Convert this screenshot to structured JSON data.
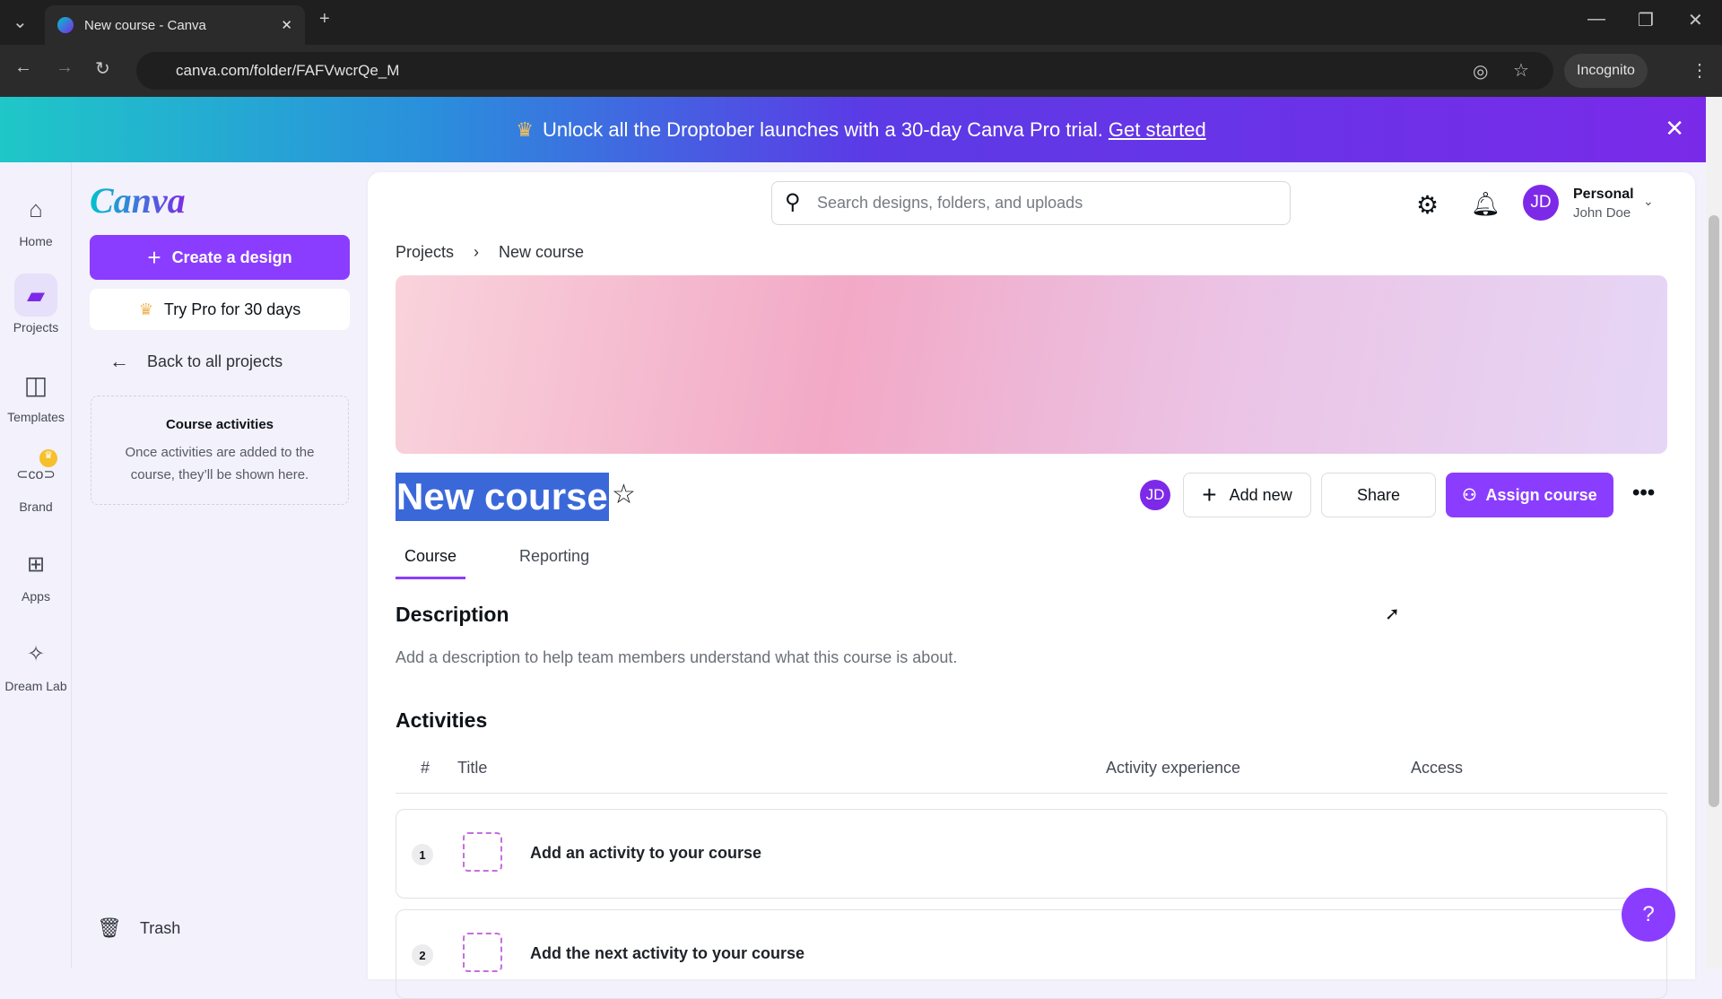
{
  "browser": {
    "tab_title": "New course - Canva",
    "url": "canva.com/folder/FAFVwcrQe_M",
    "incognito_label": "Incognito"
  },
  "promo": {
    "text": "Unlock all the Droptober launches with a 30-day Canva Pro trial.",
    "link": "Get started"
  },
  "rail": [
    {
      "label": "Home",
      "icon": "home-icon"
    },
    {
      "label": "Projects",
      "icon": "folder-icon"
    },
    {
      "label": "Templates",
      "icon": "templates-icon"
    },
    {
      "label": "Brand",
      "icon": "brand-icon"
    },
    {
      "label": "Apps",
      "icon": "apps-icon"
    },
    {
      "label": "Dream Lab",
      "icon": "dream-lab-icon"
    }
  ],
  "panel": {
    "logo": "Canva",
    "create": "Create a design",
    "pro": "Try Pro for 30 days",
    "back": "Back to all projects",
    "activities_title": "Course activities",
    "activities_text": "Once activities are added to the course, they’ll be shown here.",
    "trash": "Trash"
  },
  "header": {
    "search_placeholder": "Search designs, folders, and uploads",
    "account_type": "Personal",
    "user_name": "John Doe",
    "initials": "JD"
  },
  "breadcrumb": [
    "Projects",
    "New course"
  ],
  "course": {
    "title": "New course",
    "add_new": "Add new",
    "share": "Share",
    "assign": "Assign course"
  },
  "tabs": [
    "Course",
    "Reporting"
  ],
  "description": {
    "heading": "Description",
    "placeholder": "Add a description to help team members understand what this course is about."
  },
  "activities": {
    "heading": "Activities",
    "columns": [
      "#",
      "Title",
      "Activity experience",
      "Access"
    ],
    "rows": [
      {
        "num": "1",
        "title": "Add an activity to your course"
      },
      {
        "num": "2",
        "title": "Add the next activity to your course"
      }
    ]
  },
  "help": "?",
  "colors": {
    "accent": "#8b3dff",
    "selection": "#3b68d9"
  }
}
